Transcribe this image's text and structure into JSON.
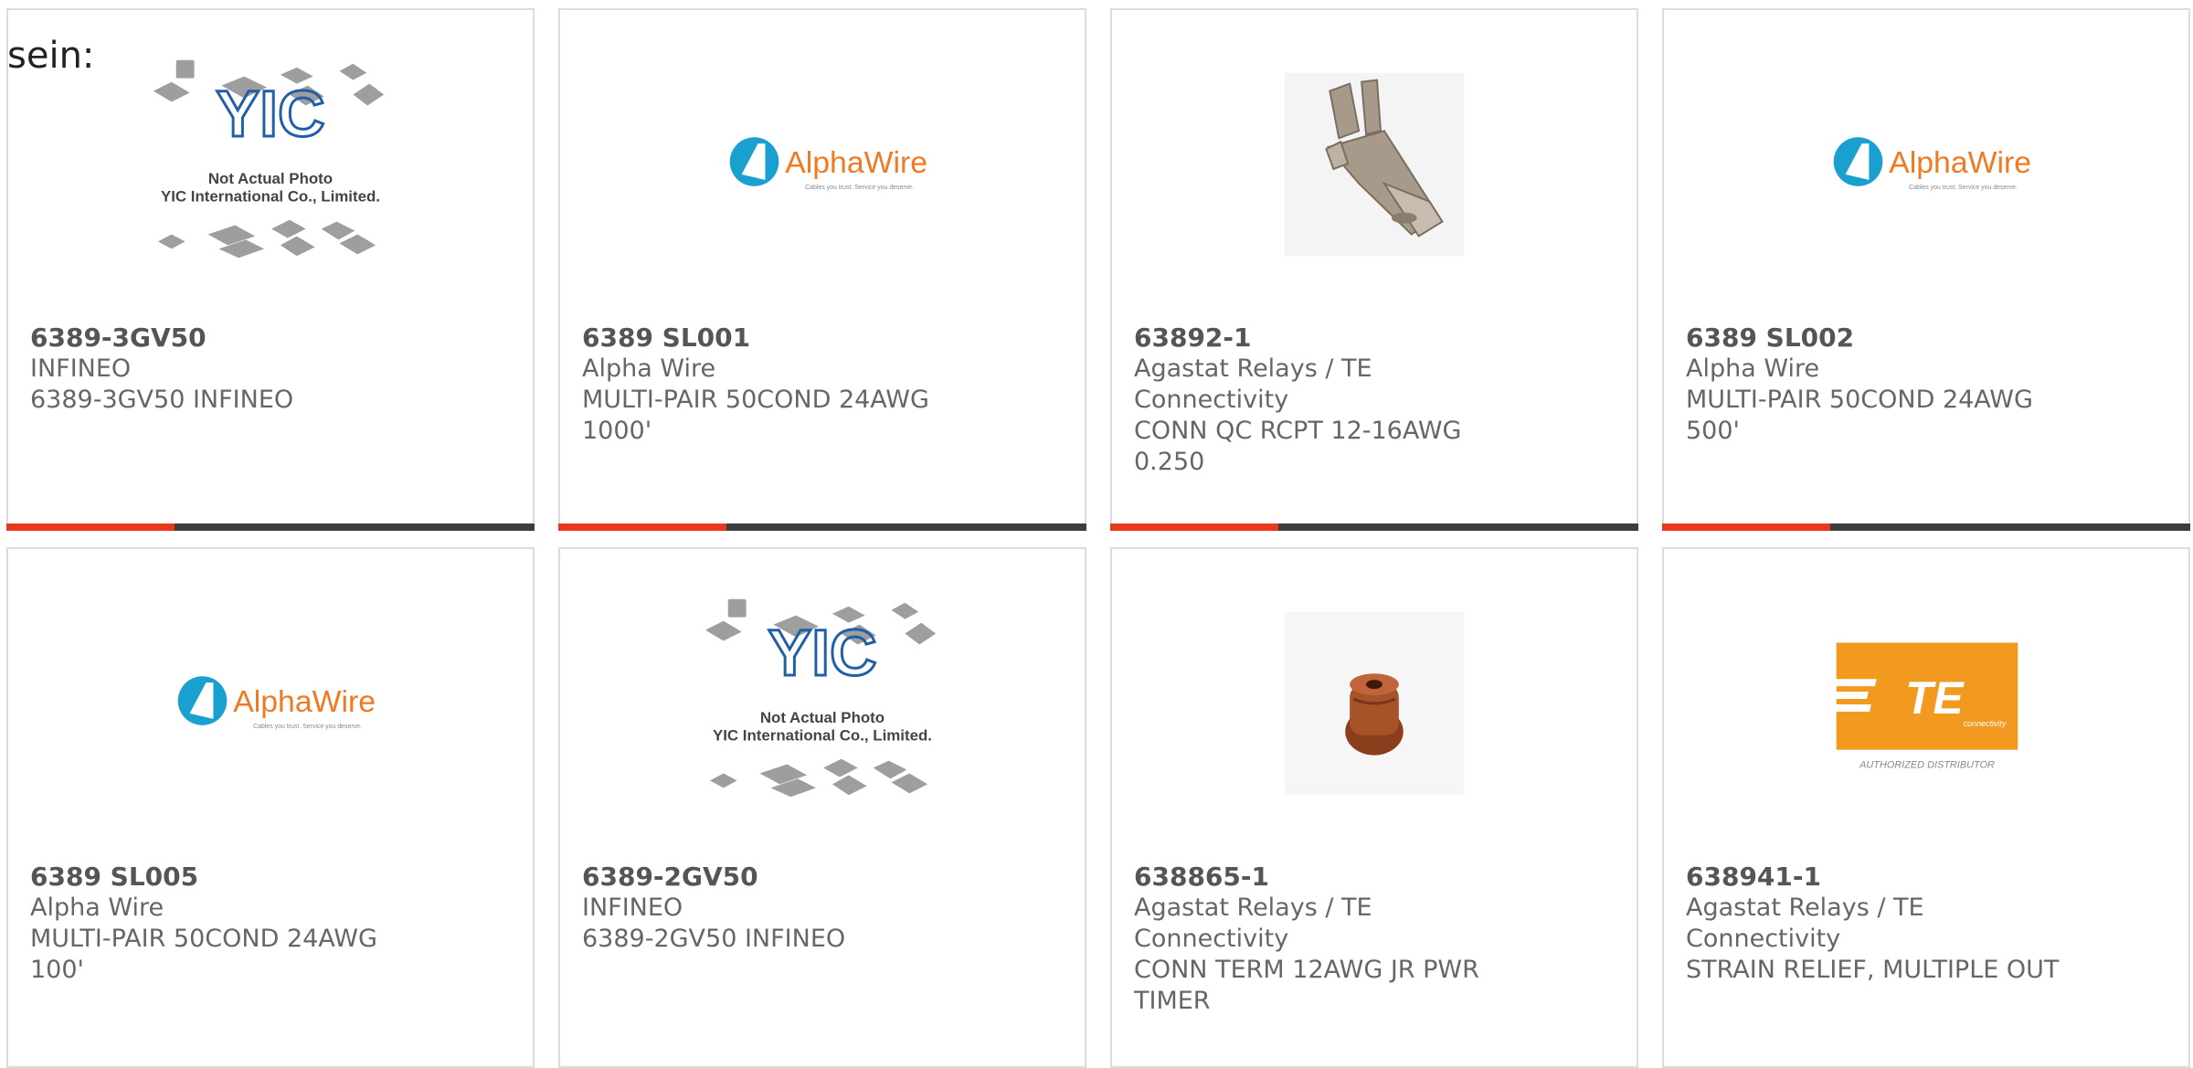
{
  "page": {
    "prefix_text": "sein:"
  },
  "colors": {
    "accent": "#e8391c",
    "bar": "#3d3d3d",
    "alpha_blue": "#1aa0d0",
    "alpha_orange": "#f07a22",
    "te_orange": "#f29a1f"
  },
  "products": [
    {
      "part": "6389-3GV50",
      "manufacturer": "INFINEO",
      "description": "6389-3GV50 INFINEO",
      "image": "yic-not-actual-photo",
      "yic_l1": "Not Actual Photo",
      "yic_l2": "YIC International Co., Limited."
    },
    {
      "part": "6389 SL001",
      "manufacturer": "Alpha Wire",
      "description": "MULTI-PAIR 50COND 24AWG 1000'",
      "image": "alphawire-logo",
      "logo": "AlphaWire",
      "tagline": "Cables you trust. Service you deserve."
    },
    {
      "part": "63892-1",
      "manufacturer": "Agastat Relays / TE Connectivity",
      "description": "CONN QC RCPT 12-16AWG 0.250",
      "image": "metal-terminal-photo"
    },
    {
      "part": "6389 SL002",
      "manufacturer": "Alpha Wire",
      "description": "MULTI-PAIR 50COND 24AWG 500'",
      "image": "alphawire-logo",
      "logo": "AlphaWire",
      "tagline": "Cables you trust. Service you deserve."
    },
    {
      "part": "6389 SL005",
      "manufacturer": "Alpha Wire",
      "description": "MULTI-PAIR 50COND 24AWG 100'",
      "image": "alphawire-logo",
      "logo": "AlphaWire",
      "tagline": "Cables you trust. Service you deserve."
    },
    {
      "part": "6389-2GV50",
      "manufacturer": "INFINEO",
      "description": "6389-2GV50 INFINEO",
      "image": "yic-not-actual-photo",
      "yic_l1": "Not Actual Photo",
      "yic_l2": "YIC International Co., Limited."
    },
    {
      "part": "638865-1",
      "manufacturer": "Agastat Relays / TE Connectivity",
      "description": "CONN TERM 12AWG JR PWR TIMER",
      "image": "rubber-seal-photo"
    },
    {
      "part": "638941-1",
      "manufacturer": "Agastat Relays / TE Connectivity",
      "description": "STRAIN RELIEF, MULTIPLE OUT",
      "image": "te-connectivity-logo",
      "logo": "TE",
      "tagline": "connectivity",
      "note": "AUTHORIZED DISTRIBUTOR"
    }
  ]
}
